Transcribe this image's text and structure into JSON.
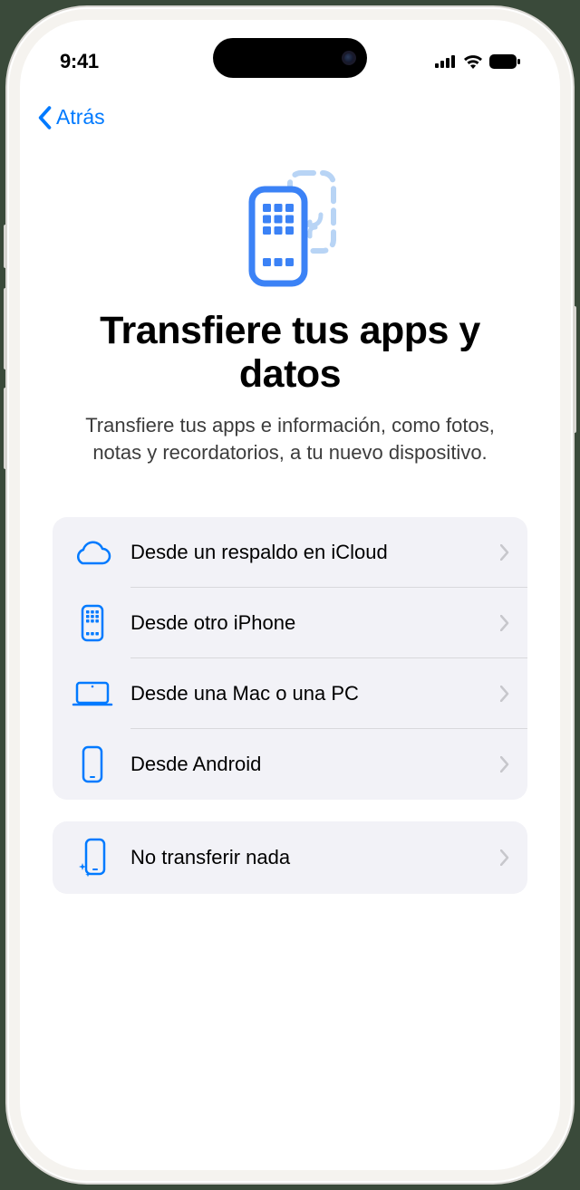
{
  "status": {
    "time": "9:41"
  },
  "nav": {
    "back_label": "Atrás"
  },
  "hero": {
    "title": "Transfiere tus apps y datos",
    "subtitle": "Transfiere tus apps e información, como fotos, notas y recordatorios, a tu nuevo dispositivo."
  },
  "options": {
    "group1": [
      {
        "icon": "cloud-icon",
        "label": "Desde un respaldo en iCloud"
      },
      {
        "icon": "iphone-apps-icon",
        "label": "Desde otro iPhone"
      },
      {
        "icon": "laptop-icon",
        "label": "Desde una Mac o una PC"
      },
      {
        "icon": "phone-icon",
        "label": "Desde Android"
      }
    ],
    "group2": [
      {
        "icon": "phone-sparkle-icon",
        "label": "No transferir nada"
      }
    ]
  },
  "colors": {
    "accent": "#007AFF"
  }
}
